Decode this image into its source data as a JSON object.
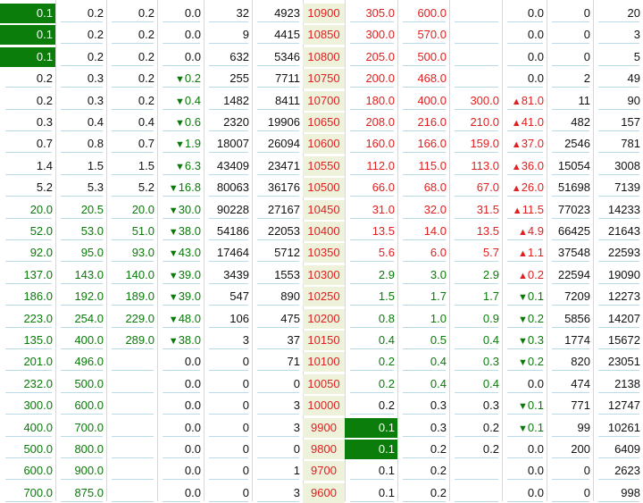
{
  "columns": [
    "call_bid",
    "call_ask",
    "call_last",
    "call_change",
    "call_volume",
    "call_oi",
    "strike",
    "put_bid",
    "put_ask",
    "put_last",
    "put_change",
    "put_volume",
    "put_oi"
  ],
  "colors": {
    "highlight": "#0b7d0b",
    "green": "#0a7a0a",
    "red": "#e02020",
    "strike_bg": "#eef2da"
  },
  "icons": {
    "up": "up-triangle-icon",
    "down": "down-triangle-icon"
  },
  "rows": [
    {
      "call_bid": "0.1",
      "call_ask": "0.2",
      "call_last": "0.2",
      "call_change": "0.0",
      "call_volume": "32",
      "call_oi": "4923",
      "strike": "10900",
      "put_bid": "305.0",
      "put_ask": "600.0",
      "put_last": "",
      "put_change": "0.0",
      "put_volume": "0",
      "put_oi": "20"
    },
    {
      "call_bid": "0.1",
      "call_ask": "0.2",
      "call_last": "0.2",
      "call_change": "0.0",
      "call_volume": "9",
      "call_oi": "4415",
      "strike": "10850",
      "put_bid": "300.0",
      "put_ask": "570.0",
      "put_last": "",
      "put_change": "0.0",
      "put_volume": "0",
      "put_oi": "3"
    },
    {
      "call_bid": "0.1",
      "call_ask": "0.2",
      "call_last": "0.2",
      "call_change": "0.0",
      "call_volume": "632",
      "call_oi": "5346",
      "strike": "10800",
      "put_bid": "205.0",
      "put_ask": "500.0",
      "put_last": "",
      "put_change": "0.0",
      "put_volume": "0",
      "put_oi": "5"
    },
    {
      "call_bid": "0.2",
      "call_ask": "0.3",
      "call_last": "0.2",
      "call_change": "▼0.2",
      "call_volume": "255",
      "call_oi": "7711",
      "strike": "10750",
      "put_bid": "200.0",
      "put_ask": "468.0",
      "put_last": "",
      "put_change": "0.0",
      "put_volume": "2",
      "put_oi": "49"
    },
    {
      "call_bid": "0.2",
      "call_ask": "0.3",
      "call_last": "0.2",
      "call_change": "▼0.4",
      "call_volume": "1482",
      "call_oi": "8411",
      "strike": "10700",
      "put_bid": "180.0",
      "put_ask": "400.0",
      "put_last": "300.0",
      "put_change": "▲81.0",
      "put_volume": "11",
      "put_oi": "90"
    },
    {
      "call_bid": "0.3",
      "call_ask": "0.4",
      "call_last": "0.4",
      "call_change": "▼0.6",
      "call_volume": "2320",
      "call_oi": "19906",
      "strike": "10650",
      "put_bid": "208.0",
      "put_ask": "216.0",
      "put_last": "210.0",
      "put_change": "▲41.0",
      "put_volume": "482",
      "put_oi": "157"
    },
    {
      "call_bid": "0.7",
      "call_ask": "0.8",
      "call_last": "0.7",
      "call_change": "▼1.9",
      "call_volume": "18007",
      "call_oi": "26094",
      "strike": "10600",
      "put_bid": "160.0",
      "put_ask": "166.0",
      "put_last": "159.0",
      "put_change": "▲37.0",
      "put_volume": "2546",
      "put_oi": "781"
    },
    {
      "call_bid": "1.4",
      "call_ask": "1.5",
      "call_last": "1.5",
      "call_change": "▼6.3",
      "call_volume": "43409",
      "call_oi": "23471",
      "strike": "10550",
      "put_bid": "112.0",
      "put_ask": "115.0",
      "put_last": "113.0",
      "put_change": "▲36.0",
      "put_volume": "15054",
      "put_oi": "3008"
    },
    {
      "call_bid": "5.2",
      "call_ask": "5.3",
      "call_last": "5.2",
      "call_change": "▼16.8",
      "call_volume": "80063",
      "call_oi": "36176",
      "strike": "10500",
      "put_bid": "66.0",
      "put_ask": "68.0",
      "put_last": "67.0",
      "put_change": "▲26.0",
      "put_volume": "51698",
      "put_oi": "7139"
    },
    {
      "call_bid": "20.0",
      "call_ask": "20.5",
      "call_last": "20.0",
      "call_change": "▼30.0",
      "call_volume": "90228",
      "call_oi": "27167",
      "strike": "10450",
      "put_bid": "31.0",
      "put_ask": "32.0",
      "put_last": "31.5",
      "put_change": "▲11.5",
      "put_volume": "77023",
      "put_oi": "14233"
    },
    {
      "call_bid": "52.0",
      "call_ask": "53.0",
      "call_last": "51.0",
      "call_change": "▼38.0",
      "call_volume": "54186",
      "call_oi": "22053",
      "strike": "10400",
      "put_bid": "13.5",
      "put_ask": "14.0",
      "put_last": "13.5",
      "put_change": "▲4.9",
      "put_volume": "66425",
      "put_oi": "21643"
    },
    {
      "call_bid": "92.0",
      "call_ask": "95.0",
      "call_last": "93.0",
      "call_change": "▼43.0",
      "call_volume": "17464",
      "call_oi": "5712",
      "strike": "10350",
      "put_bid": "5.6",
      "put_ask": "6.0",
      "put_last": "5.7",
      "put_change": "▲1.1",
      "put_volume": "37548",
      "put_oi": "22593"
    },
    {
      "call_bid": "137.0",
      "call_ask": "143.0",
      "call_last": "140.0",
      "call_change": "▼39.0",
      "call_volume": "3439",
      "call_oi": "1553",
      "strike": "10300",
      "put_bid": "2.9",
      "put_ask": "3.0",
      "put_last": "2.9",
      "put_change": "▲0.2",
      "put_volume": "22594",
      "put_oi": "19090"
    },
    {
      "call_bid": "186.0",
      "call_ask": "192.0",
      "call_last": "189.0",
      "call_change": "▼39.0",
      "call_volume": "547",
      "call_oi": "890",
      "strike": "10250",
      "put_bid": "1.5",
      "put_ask": "1.7",
      "put_last": "1.7",
      "put_change": "▼0.1",
      "put_volume": "7209",
      "put_oi": "12273"
    },
    {
      "call_bid": "223.0",
      "call_ask": "254.0",
      "call_last": "229.0",
      "call_change": "▼48.0",
      "call_volume": "106",
      "call_oi": "475",
      "strike": "10200",
      "put_bid": "0.8",
      "put_ask": "1.0",
      "put_last": "0.9",
      "put_change": "▼0.2",
      "put_volume": "5856",
      "put_oi": "14207"
    },
    {
      "call_bid": "135.0",
      "call_ask": "400.0",
      "call_last": "289.0",
      "call_change": "▼38.0",
      "call_volume": "3",
      "call_oi": "37",
      "strike": "10150",
      "put_bid": "0.4",
      "put_ask": "0.5",
      "put_last": "0.4",
      "put_change": "▼0.3",
      "put_volume": "1774",
      "put_oi": "15672"
    },
    {
      "call_bid": "201.0",
      "call_ask": "496.0",
      "call_last": "",
      "call_change": "0.0",
      "call_volume": "0",
      "call_oi": "71",
      "strike": "10100",
      "put_bid": "0.2",
      "put_ask": "0.4",
      "put_last": "0.3",
      "put_change": "▼0.2",
      "put_volume": "820",
      "put_oi": "23051"
    },
    {
      "call_bid": "232.0",
      "call_ask": "500.0",
      "call_last": "",
      "call_change": "0.0",
      "call_volume": "0",
      "call_oi": "0",
      "strike": "10050",
      "put_bid": "0.2",
      "put_ask": "0.4",
      "put_last": "0.4",
      "put_change": "0.0",
      "put_volume": "474",
      "put_oi": "2138"
    },
    {
      "call_bid": "300.0",
      "call_ask": "600.0",
      "call_last": "",
      "call_change": "0.0",
      "call_volume": "0",
      "call_oi": "3",
      "strike": "10000",
      "put_bid": "0.2",
      "put_ask": "0.3",
      "put_last": "0.3",
      "put_change": "▼0.1",
      "put_volume": "771",
      "put_oi": "12747"
    },
    {
      "call_bid": "400.0",
      "call_ask": "700.0",
      "call_last": "",
      "call_change": "0.0",
      "call_volume": "0",
      "call_oi": "3",
      "strike": "9900",
      "put_bid": "0.1",
      "put_ask": "0.3",
      "put_last": "0.2",
      "put_change": "▼0.1",
      "put_volume": "99",
      "put_oi": "10261"
    },
    {
      "call_bid": "500.0",
      "call_ask": "800.0",
      "call_last": "",
      "call_change": "0.0",
      "call_volume": "0",
      "call_oi": "0",
      "strike": "9800",
      "put_bid": "0.1",
      "put_ask": "0.2",
      "put_last": "0.2",
      "put_change": "0.0",
      "put_volume": "200",
      "put_oi": "6409"
    },
    {
      "call_bid": "600.0",
      "call_ask": "900.0",
      "call_last": "",
      "call_change": "0.0",
      "call_volume": "0",
      "call_oi": "1",
      "strike": "9700",
      "put_bid": "0.1",
      "put_ask": "0.2",
      "put_last": "",
      "put_change": "0.0",
      "put_volume": "0",
      "put_oi": "2623"
    },
    {
      "call_bid": "700.0",
      "call_ask": "875.0",
      "call_last": "",
      "call_change": "0.0",
      "call_volume": "0",
      "call_oi": "3",
      "strike": "9600",
      "put_bid": "0.1",
      "put_ask": "0.2",
      "put_last": "",
      "put_change": "0.0",
      "put_volume": "0",
      "put_oi": "998"
    }
  ]
}
